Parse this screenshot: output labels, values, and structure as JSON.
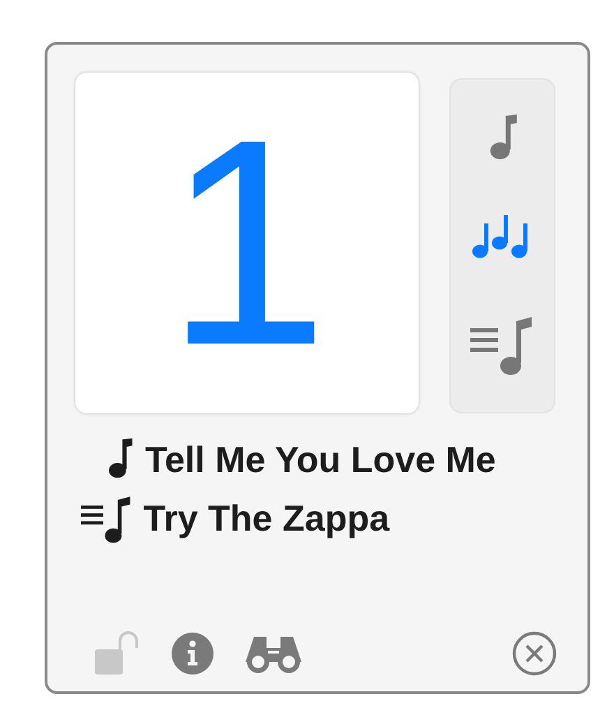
{
  "counter": {
    "value": "1"
  },
  "modes": [
    {
      "kind": "song",
      "selected": false
    },
    {
      "kind": "multiple",
      "selected": true
    },
    {
      "kind": "playlist",
      "selected": false
    }
  ],
  "now_playing": {
    "track": "Tell Me You Love Me",
    "playlist": "Try The Zappa"
  },
  "lock": {
    "locked": false
  }
}
